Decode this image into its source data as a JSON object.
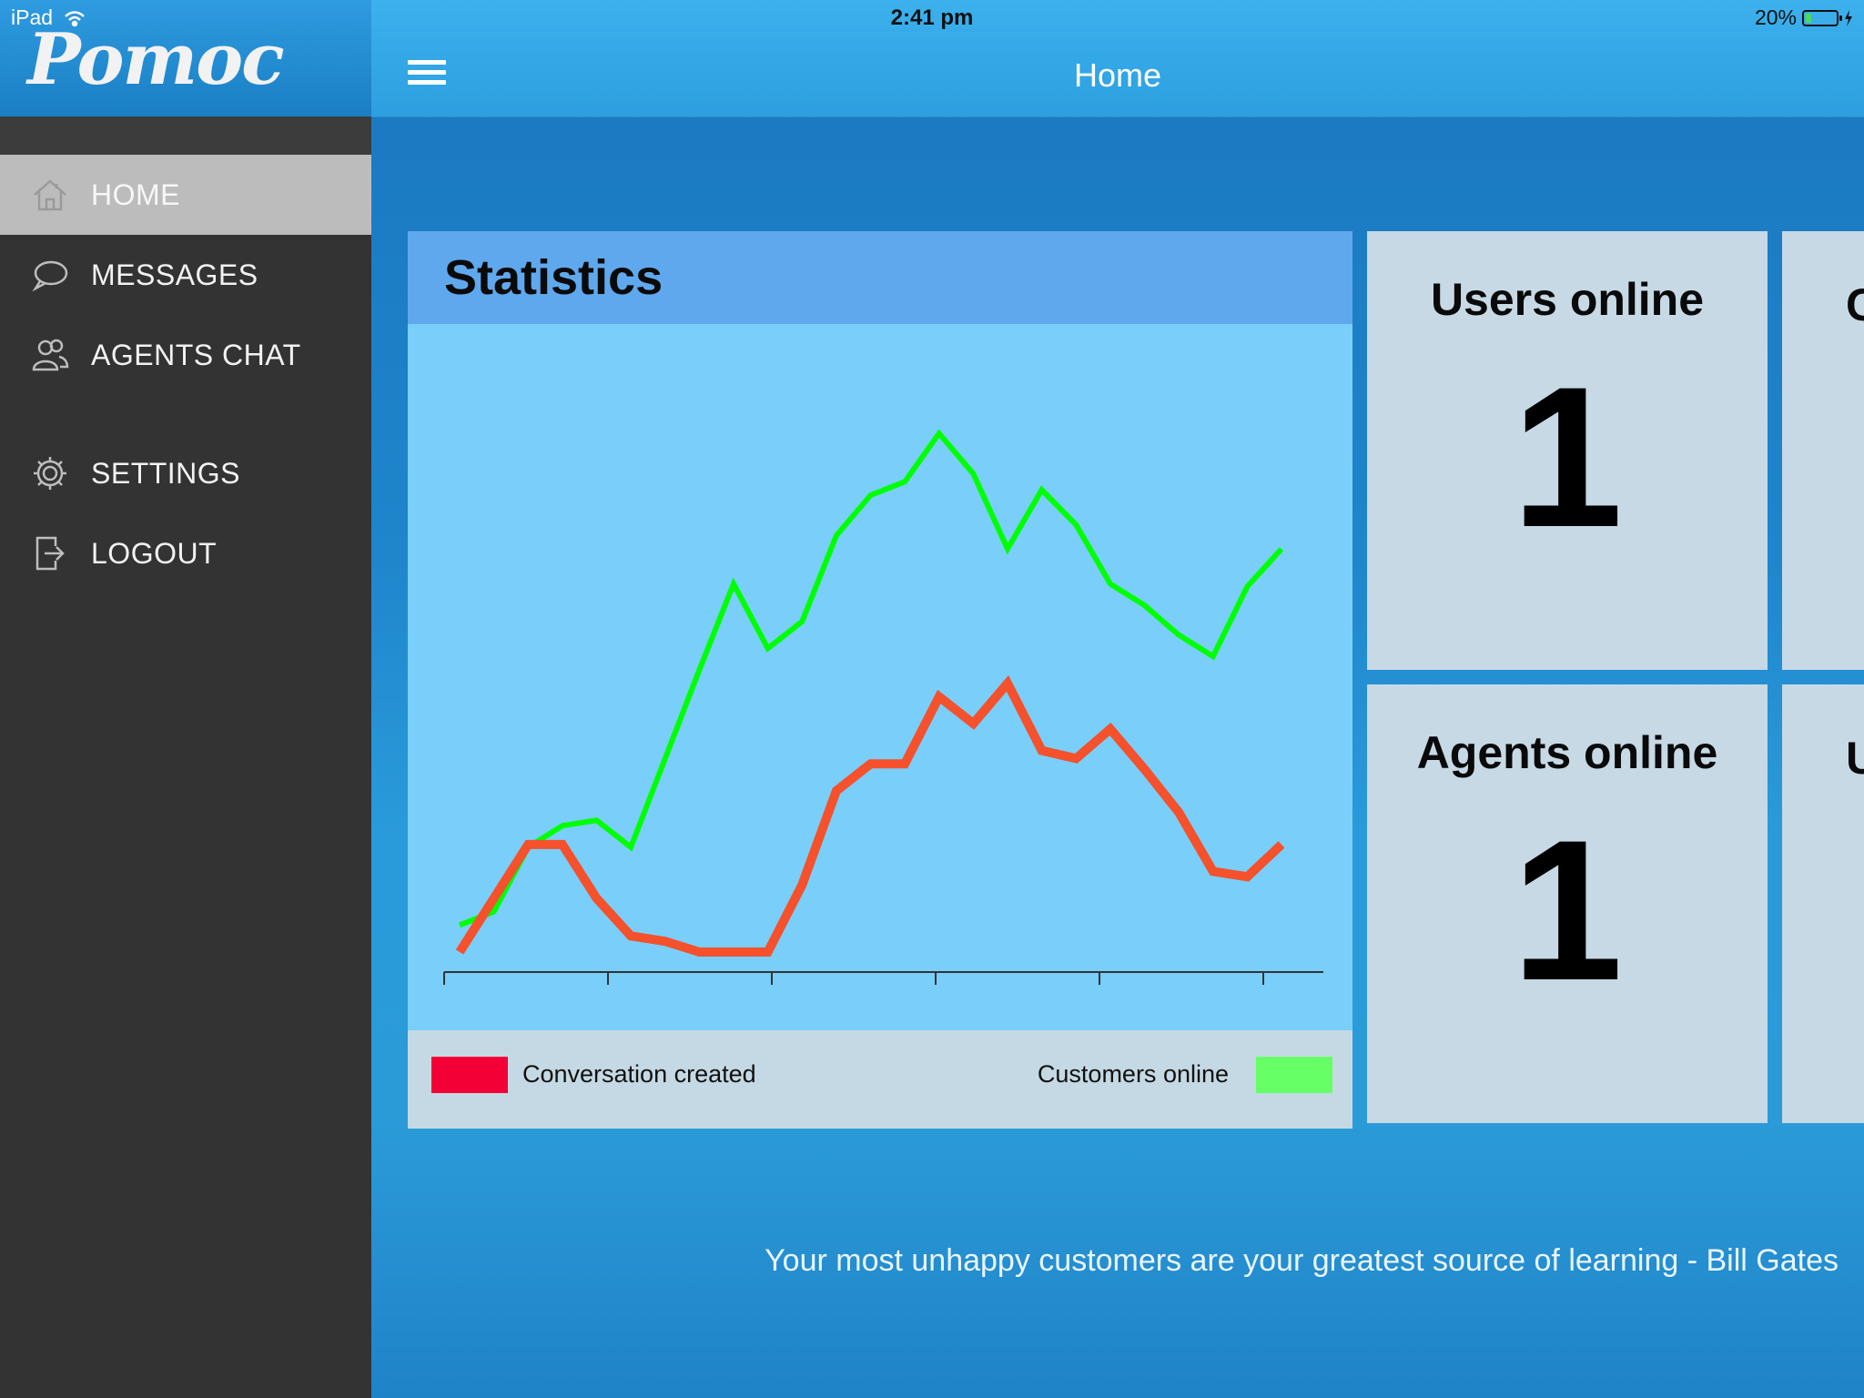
{
  "status_bar": {
    "device": "iPad",
    "time": "2:41 pm",
    "battery": "20%",
    "battery_level": 0.2
  },
  "sidebar": {
    "logo": "Pomoc",
    "items": [
      {
        "label": "HOME",
        "icon": "home-icon",
        "active": true
      },
      {
        "label": "MESSAGES",
        "icon": "speech-bubble-icon"
      },
      {
        "label": "AGENTS CHAT",
        "icon": "users-icon"
      },
      {
        "label": "SETTINGS",
        "icon": "gear-icon"
      },
      {
        "label": "LOGOUT",
        "icon": "logout-icon"
      }
    ]
  },
  "header": {
    "title": "Home"
  },
  "statistics": {
    "title": "Statistics",
    "legend": [
      {
        "label": "Conversation created",
        "color": "#f20036"
      },
      {
        "label": "Customers online",
        "color": "#66ff66"
      }
    ]
  },
  "chart_data": {
    "type": "line",
    "x": [
      0,
      1,
      2,
      3,
      4,
      5,
      6,
      7,
      8,
      9,
      10,
      11,
      12,
      13,
      14,
      15,
      16,
      17,
      18,
      19,
      20,
      21,
      22,
      23,
      24
    ],
    "series": [
      {
        "name": "Conversation created",
        "color": "#f4512c",
        "values": [
          0,
          2,
          4,
          4,
          2,
          0.6,
          0.4,
          0,
          0,
          0,
          2.5,
          6,
          7,
          7,
          9.5,
          8.5,
          10,
          7.5,
          7.2,
          8.3,
          6.8,
          5.2,
          3,
          2.8,
          4
        ]
      },
      {
        "name": "Customers online",
        "color": "#00ff00",
        "values": [
          1,
          1.5,
          3.9,
          4.7,
          4.9,
          3.9,
          7.2,
          10.5,
          13.7,
          11.3,
          12.3,
          15.5,
          17,
          17.5,
          19.3,
          17.8,
          15,
          17.2,
          15.9,
          13.7,
          12.9,
          11.8,
          11,
          13.6,
          15
        ]
      }
    ],
    "ylim": [
      0,
      21
    ],
    "x_ticks": 6,
    "grid": false,
    "legend_position": "bottom"
  },
  "tiles": [
    {
      "title": "Users online",
      "value": "1"
    },
    {
      "title": "Agents online",
      "value": "1"
    },
    {
      "title": "C",
      "value": ""
    },
    {
      "title": "U",
      "value": ""
    }
  ],
  "quote": "Your most unhappy customers are your greatest source of learning - Bill Gates"
}
